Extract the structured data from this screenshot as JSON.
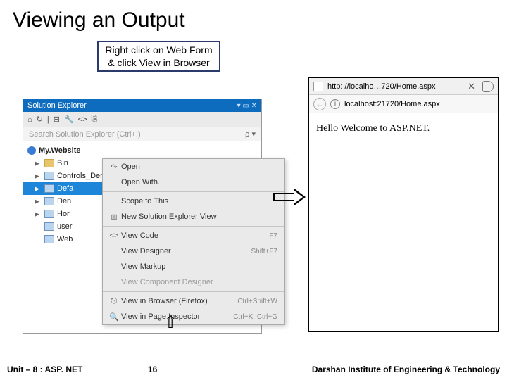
{
  "title": "Viewing an Output",
  "callout": "Right click on Web Form & click View in Browser",
  "solution_explorer": {
    "header": "Solution Explorer",
    "search_placeholder": "Search Solution Explorer (Ctrl+;)",
    "tree": {
      "root": "My.Website",
      "items": [
        {
          "label": "Bin"
        },
        {
          "label": "Controls_Demo.aspx"
        },
        {
          "label": "Defa",
          "selected": true
        },
        {
          "label": "Den"
        },
        {
          "label": "Hor"
        },
        {
          "label": "user"
        },
        {
          "label": "Web"
        }
      ]
    }
  },
  "context_menu": {
    "items": [
      {
        "label": "Open",
        "icon": "↷"
      },
      {
        "label": "Open With..."
      },
      {
        "sep": true
      },
      {
        "label": "Scope to This"
      },
      {
        "label": "New Solution Explorer View",
        "icon": "⊞"
      },
      {
        "sep": true
      },
      {
        "label": "View Code",
        "icon": "<>",
        "shortcut": "F7"
      },
      {
        "label": "View Designer",
        "shortcut": "Shift+F7"
      },
      {
        "label": "View Markup"
      },
      {
        "label": "View Component Designer"
      },
      {
        "sep": true
      },
      {
        "label": "View in Browser (Firefox)",
        "icon": "⎋",
        "shortcut": "Ctrl+Shift+W"
      },
      {
        "label": "View in Page Inspector",
        "icon": "🔍",
        "shortcut": "Ctrl+K, Ctrl+G"
      }
    ]
  },
  "browser": {
    "tab_url": "http: //localho…720/Home.aspx",
    "addr_url": "localhost:21720/Home.aspx",
    "body": "Hello Welcome to ASP.NET."
  },
  "footer": {
    "unit": "Unit – 8 : ASP. NET",
    "page": "16",
    "institute": "Darshan Institute of Engineering & Technology"
  }
}
